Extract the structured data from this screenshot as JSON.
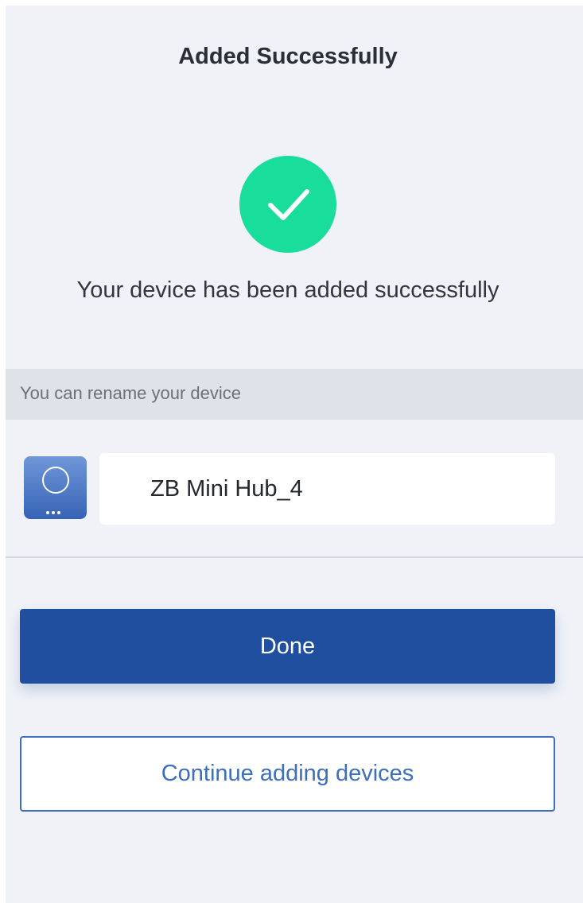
{
  "header": {
    "title": "Added Successfully"
  },
  "status": {
    "icon": "check-icon",
    "color": "#19dd9a",
    "message": "Your device has been added successfully"
  },
  "rename": {
    "hint": "You can rename your device",
    "device_icon": "hub-device-icon",
    "device_name": "ZB Mini Hub_4"
  },
  "actions": {
    "done_label": "Done",
    "continue_label": "Continue adding devices",
    "primary_color": "#1f4f9e",
    "outline_color": "#3d6dbd"
  }
}
